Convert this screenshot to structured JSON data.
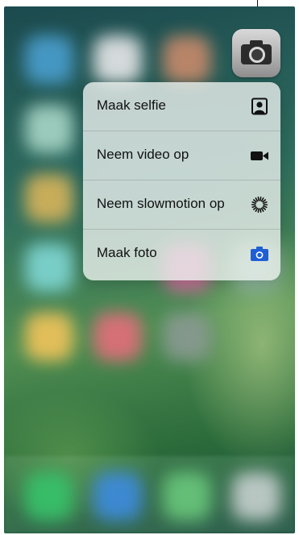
{
  "home_screen": {
    "app": {
      "name": "camera-app-icon",
      "icon": "camera-icon"
    },
    "blur_colors": {
      "app1": "#4a9fd0",
      "app2": "#e8e8ea",
      "app3": "#c98a6b",
      "app4": "#a7d6c6",
      "app5": "#d8b45a",
      "app6": "#7fd7d4",
      "app7": "#d76ea0",
      "app8": "#8fb7a1",
      "app9": "#f2c45a",
      "app10": "#e46d7b",
      "app11": "#8a9a92",
      "dock1": "#36c36a",
      "dock2": "#3d8be0",
      "dock3": "#69c77b",
      "dock4": "#c7d0cf"
    }
  },
  "quick_actions": [
    {
      "label": "Maak selfie",
      "icon": "selfie-portrait-icon"
    },
    {
      "label": "Neem video op",
      "icon": "video-camera-icon"
    },
    {
      "label": "Neem slowmotion op",
      "icon": "slowmotion-icon"
    },
    {
      "label": "Maak foto",
      "icon": "camera-icon",
      "icon_color": "#1f5fd6"
    }
  ]
}
